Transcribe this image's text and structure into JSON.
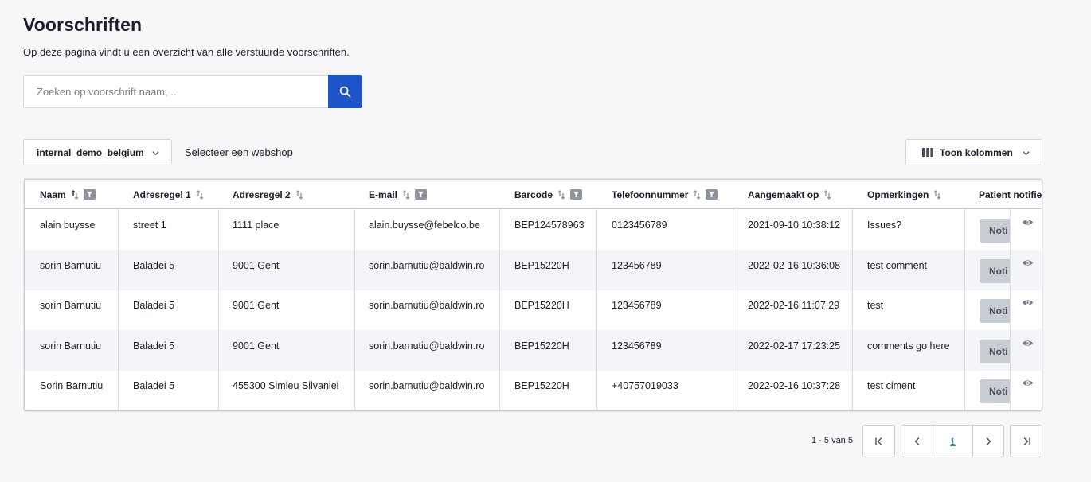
{
  "page": {
    "title": "Voorschriften",
    "subtitle": "Op deze pagina vindt u een overzicht van alle verstuurde voorschriften."
  },
  "search": {
    "placeholder": "Zoeken op voorschrift naam, ...",
    "value": "",
    "button_icon": "search-icon"
  },
  "filters": {
    "webshop_value": "internal_demo_belgium",
    "webshop_label": "Selecteer een webshop",
    "columns_button": "Toon kolommen",
    "columns_icon": "columns-icon"
  },
  "table": {
    "headers": [
      {
        "label": "Naam",
        "sort": "active",
        "filter": true
      },
      {
        "label": "Adresregel 1",
        "sort": "default",
        "filter": false
      },
      {
        "label": "Adresregel 2",
        "sort": "default",
        "filter": false
      },
      {
        "label": "E-mail",
        "sort": "default",
        "filter": true
      },
      {
        "label": "Barcode",
        "sort": "default",
        "filter": true
      },
      {
        "label": "Telefoonnummer",
        "sort": "default",
        "filter": true
      },
      {
        "label": "Aangemaakt op",
        "sort": "default",
        "filter": false
      },
      {
        "label": "Opmerkingen",
        "sort": "default",
        "filter": false
      },
      {
        "label": "Patient notifie",
        "sort": "none",
        "filter": false
      }
    ],
    "rows": [
      {
        "naam": "alain buysse",
        "adres1": "street 1",
        "adres2": "1111 place",
        "email": "alain.buysse@febelco.be",
        "barcode": "BEP124578963",
        "telefoon": "0123456789",
        "aangemaakt": "2021-09-10 10:38:12",
        "opmerkingen": "Issues?",
        "action": "Noti"
      },
      {
        "naam": "sorin Barnutiu",
        "adres1": "Baladei 5",
        "adres2": "9001 Gent",
        "email": "sorin.barnutiu@baldwin.ro",
        "barcode": "BEP15220H",
        "telefoon": "123456789",
        "aangemaakt": "2022-02-16 10:36:08",
        "opmerkingen": "test comment",
        "action": "Noti"
      },
      {
        "naam": "sorin Barnutiu",
        "adres1": "Baladei 5",
        "adres2": "9001 Gent",
        "email": "sorin.barnutiu@baldwin.ro",
        "barcode": "BEP15220H",
        "telefoon": "123456789",
        "aangemaakt": "2022-02-16 11:07:29",
        "opmerkingen": "test",
        "action": "Noti"
      },
      {
        "naam": "sorin Barnutiu",
        "adres1": "Baladei 5",
        "adres2": "9001 Gent",
        "email": "sorin.barnutiu@baldwin.ro",
        "barcode": "BEP15220H",
        "telefoon": "123456789",
        "aangemaakt": "2022-02-17 17:23:25",
        "opmerkingen": "comments go here",
        "action": "Noti"
      },
      {
        "naam": "Sorin Barnutiu",
        "adres1": "Baladei 5",
        "adres2": "455300 Simleu Silvaniei",
        "email": "sorin.barnutiu@baldwin.ro",
        "barcode": "BEP15220H",
        "telefoon": "+40757019033",
        "aangemaakt": "2022-02-16 10:37:28",
        "opmerkingen": "test ciment",
        "action": "Noti"
      }
    ],
    "row_action_icon": "eye-icon"
  },
  "pagination": {
    "summary": "1 - 5 van 5",
    "current_page": "1",
    "first_icon": "first-page-icon",
    "prev_icon": "chevron-left-icon",
    "next_icon": "chevron-right-icon",
    "last_icon": "last-page-icon"
  },
  "colors": {
    "accent": "#1d55c8",
    "page_bg": "#f7f7f9",
    "link": "#1d8fb5"
  }
}
